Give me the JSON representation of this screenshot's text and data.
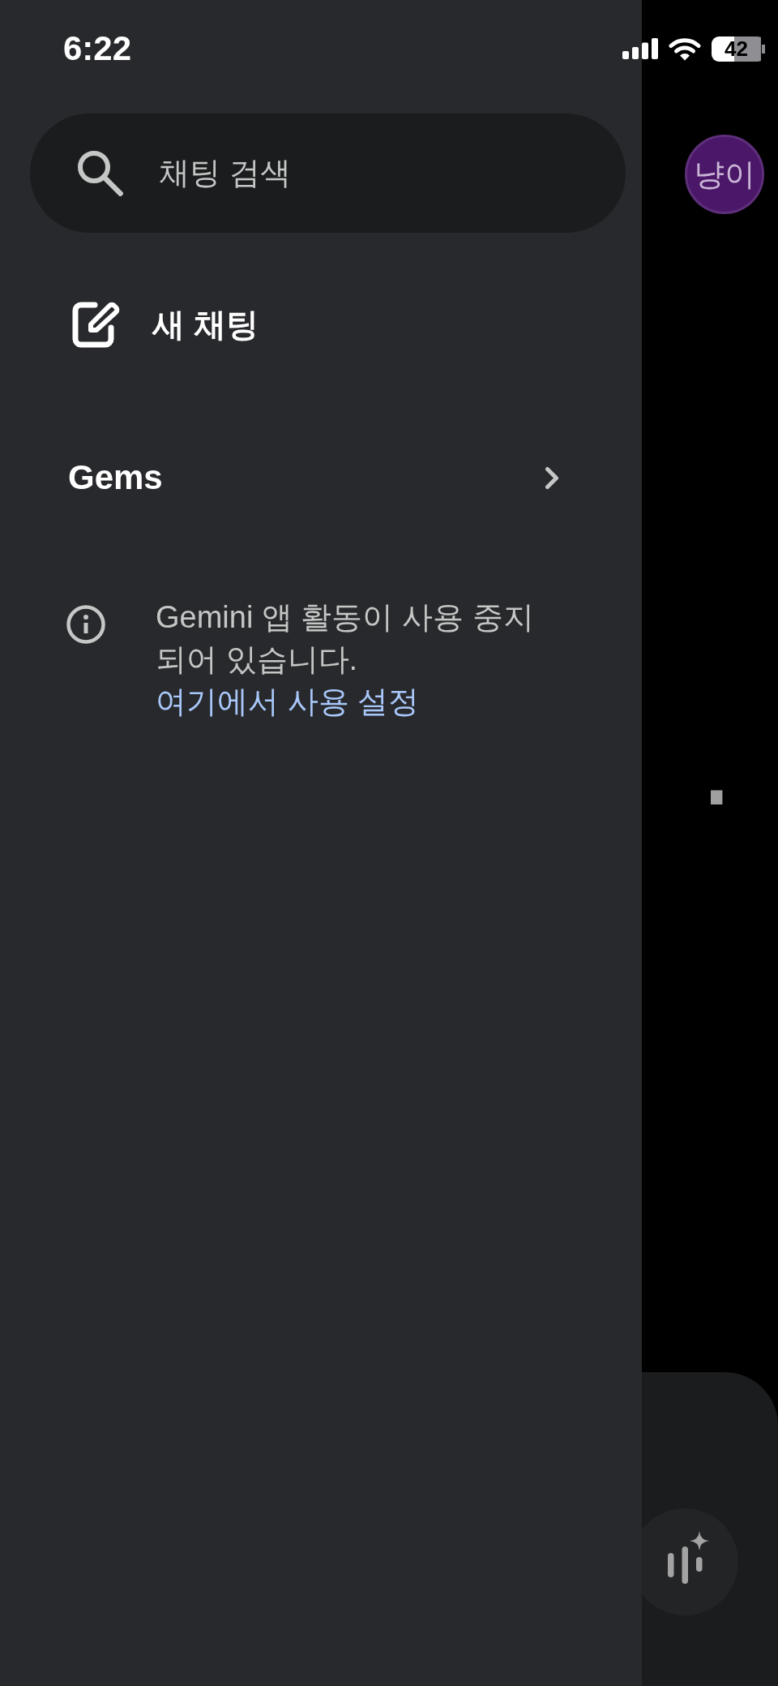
{
  "status_bar": {
    "time": "6:22",
    "battery": "42"
  },
  "drawer": {
    "search": {
      "placeholder": "채팅 검색"
    },
    "new_chat": {
      "label": "새 채팅"
    },
    "gems": {
      "label": "Gems"
    },
    "notice": {
      "text": "Gemini 앱 활동이 사용 중지되어 있습니다.",
      "link": "여기에서 사용 설정"
    }
  },
  "main": {
    "avatar": "냥이",
    "heading_tail": "."
  }
}
